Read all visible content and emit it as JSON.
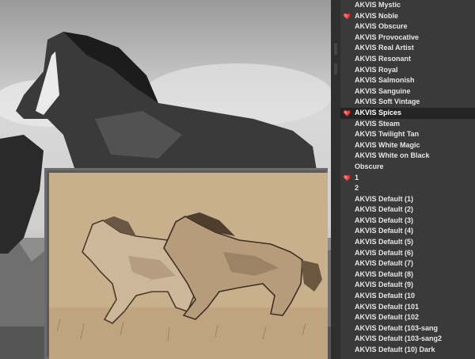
{
  "colors": {
    "heart": "#e02020",
    "panel_bg": "#3a3a3a",
    "selected_bg": "#242424",
    "preview_bg": "#c9b08c"
  },
  "presets": [
    {
      "label": "AKVIS Mystic",
      "favorite": false,
      "selected": false
    },
    {
      "label": "AKVIS Noble",
      "favorite": true,
      "selected": false
    },
    {
      "label": "AKVIS Obscure",
      "favorite": false,
      "selected": false
    },
    {
      "label": "AKVIS Provocative",
      "favorite": false,
      "selected": false
    },
    {
      "label": "AKVIS Real Artist",
      "favorite": false,
      "selected": false
    },
    {
      "label": "AKVIS Resonant",
      "favorite": false,
      "selected": false
    },
    {
      "label": "AKVIS Royal",
      "favorite": false,
      "selected": false
    },
    {
      "label": "AKVIS Salmonish",
      "favorite": false,
      "selected": false
    },
    {
      "label": "AKVIS Sanguine",
      "favorite": false,
      "selected": false
    },
    {
      "label": "AKVIS Soft Vintage",
      "favorite": false,
      "selected": false
    },
    {
      "label": "AKVIS Spices",
      "favorite": true,
      "selected": true
    },
    {
      "label": "AKVIS Steam",
      "favorite": false,
      "selected": false
    },
    {
      "label": "AKVIS Twilight Tan",
      "favorite": false,
      "selected": false
    },
    {
      "label": "AKVIS White Magic",
      "favorite": false,
      "selected": false
    },
    {
      "label": "AKVIS White on Black",
      "favorite": false,
      "selected": false
    },
    {
      "label": "Obscure",
      "favorite": false,
      "selected": false
    },
    {
      "label": "1",
      "favorite": true,
      "selected": false
    },
    {
      "label": "2",
      "favorite": false,
      "selected": false
    },
    {
      "label": "AKVIS Default (1)",
      "favorite": false,
      "selected": false
    },
    {
      "label": "AKVIS Default (2)",
      "favorite": false,
      "selected": false
    },
    {
      "label": "AKVIS Default (3)",
      "favorite": false,
      "selected": false
    },
    {
      "label": "AKVIS Default (4)",
      "favorite": false,
      "selected": false
    },
    {
      "label": "AKVIS Default (5)",
      "favorite": false,
      "selected": false
    },
    {
      "label": "AKVIS Default (6)",
      "favorite": false,
      "selected": false
    },
    {
      "label": "AKVIS Default (7)",
      "favorite": false,
      "selected": false
    },
    {
      "label": "AKVIS Default (8)",
      "favorite": false,
      "selected": false
    },
    {
      "label": "AKVIS Default (9)",
      "favorite": false,
      "selected": false
    },
    {
      "label": "AKVIS Default (10",
      "favorite": false,
      "selected": false
    },
    {
      "label": "AKVIS Default (101",
      "favorite": false,
      "selected": false
    },
    {
      "label": "AKVIS Default (102",
      "favorite": false,
      "selected": false
    },
    {
      "label": "AKVIS Default (103-sang",
      "favorite": false,
      "selected": false
    },
    {
      "label": "AKVIS Default (103-sang2",
      "favorite": false,
      "selected": false
    },
    {
      "label": "AKVIS Default (10) Dark",
      "favorite": false,
      "selected": false
    }
  ]
}
